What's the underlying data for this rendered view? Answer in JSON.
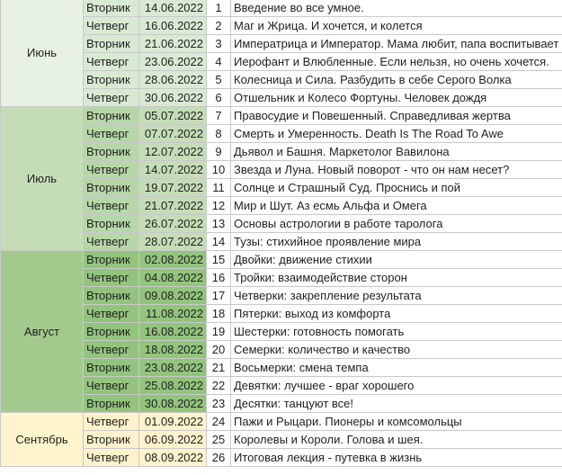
{
  "months": [
    {
      "name": "Июнь",
      "key": "june",
      "rows": [
        {
          "day": "Вторник",
          "date": "14.06.2022",
          "num": "1",
          "topic": "Введение во все умное."
        },
        {
          "day": "Четверг",
          "date": "16.06.2022",
          "num": "2",
          "topic": "Маг и Жрица. И хочется, и колется"
        },
        {
          "day": "Вторник",
          "date": "21.06.2022",
          "num": "3",
          "topic": "Императрица и Император. Мама любит, папа воспитывает"
        },
        {
          "day": "Четверг",
          "date": "23.06.2022",
          "num": "4",
          "topic": "Иерофант и Влюбленные. Если нельзя, но очень хочется."
        },
        {
          "day": "Вторник",
          "date": "28.06.2022",
          "num": "5",
          "topic": "Колесница и Сила. Разбудить в себе Серого Волка"
        },
        {
          "day": "Четверг",
          "date": "30.06.2022",
          "num": "6",
          "topic": "Отшельник и Колесо Фортуны. Человек дождя"
        }
      ]
    },
    {
      "name": "Июль",
      "key": "july",
      "rows": [
        {
          "day": "Вторник",
          "date": "05.07.2022",
          "num": "7",
          "topic": "Правосудие и Повешенный. Справедливая жертва"
        },
        {
          "day": "Четверг",
          "date": "07.07.2022",
          "num": "8",
          "topic": "Смерть и Умеренность. Death Is The Road To Awe"
        },
        {
          "day": "Вторник",
          "date": "12.07.2022",
          "num": "9",
          "topic": "Дьявол и Башня. Маркетолог Вавилона"
        },
        {
          "day": "Четверг",
          "date": "14.07.2022",
          "num": "10",
          "topic": "Звезда и Луна. Новый поворот - что он нам несет?"
        },
        {
          "day": "Вторник",
          "date": "19.07.2022",
          "num": "11",
          "topic": "Солнце и Страшный Суд. Проснись и пой"
        },
        {
          "day": "Четверг",
          "date": "21.07.2022",
          "num": "12",
          "topic": "Мир и Шут. Аз есмь Альфа и Омега"
        },
        {
          "day": "Вторник",
          "date": "26.07.2022",
          "num": "13",
          "topic": "Основы астрологии в работе таролога"
        },
        {
          "day": "Четверг",
          "date": "28.07.2022",
          "num": "14",
          "topic": "Тузы: стихийное проявление мира"
        }
      ]
    },
    {
      "name": "Август",
      "key": "aug",
      "rows": [
        {
          "day": "Вторник",
          "date": "02.08.2022",
          "num": "15",
          "topic": "Двойки: движение стихии"
        },
        {
          "day": "Четверг",
          "date": "04.08.2022",
          "num": "16",
          "topic": "Тройки: взаимодействие сторон"
        },
        {
          "day": "Вторник",
          "date": "09.08.2022",
          "num": "17",
          "topic": "Четверки: закрепление результата"
        },
        {
          "day": "Четверг",
          "date": "11.08.2022",
          "num": "18",
          "topic": "Пятерки: выход из комфорта"
        },
        {
          "day": "Вторник",
          "date": "16.08.2022",
          "num": "19",
          "topic": "Шестерки: готовность помогать"
        },
        {
          "day": "Четверг",
          "date": "18.08.2022",
          "num": "20",
          "topic": "Семерки: количество и качество"
        },
        {
          "day": "Вторник",
          "date": "23.08.2022",
          "num": "21",
          "topic": "Восьмерки: смена темпа"
        },
        {
          "day": "Четверг",
          "date": "25.08.2022",
          "num": "22",
          "topic": "Девятки: лучшее - враг хорошего"
        },
        {
          "day": "Вторник",
          "date": "30.08.2022",
          "num": "23",
          "topic": "Десятки: танцуют все!"
        }
      ]
    },
    {
      "name": "Сентябрь",
      "key": "sep",
      "rows": [
        {
          "day": "Четверг",
          "date": "01.09.2022",
          "num": "24",
          "topic": "Пажи и Рыцари. Пионеры и комсомольцы"
        },
        {
          "day": "Вторник",
          "date": "06.09.2022",
          "num": "25",
          "topic": "Королевы и Короли. Голова и шея."
        },
        {
          "day": "Четверг",
          "date": "08.09.2022",
          "num": "26",
          "topic": "Итоговая лекция - путевка в жизнь"
        }
      ]
    }
  ]
}
